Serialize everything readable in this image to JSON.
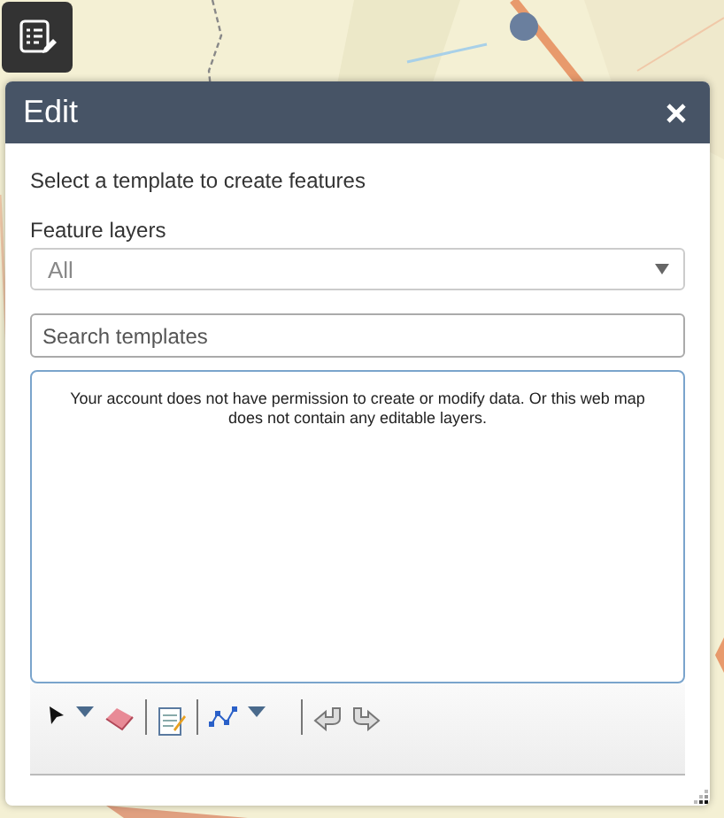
{
  "panel": {
    "title": "Edit",
    "instruction": "Select a template to create features",
    "layers_label": "Feature layers",
    "layers_select": {
      "value": "All"
    },
    "search": {
      "placeholder": "Search templates"
    },
    "message": "Your account does not have permission to create or modify data. Or this web map does not contain any editable layers."
  }
}
